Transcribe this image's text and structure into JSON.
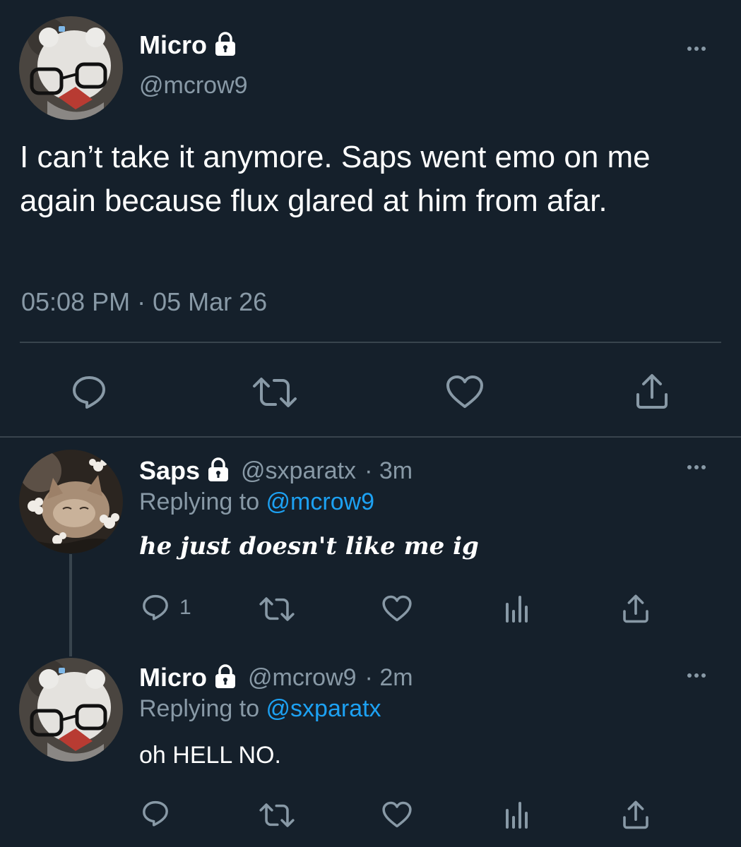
{
  "main_tweet": {
    "display_name": "Micro",
    "handle": "@mcrow9",
    "text": "I can’t take it anymore. Saps went emo on me again because flux glared at him from afar.",
    "timestamp": "05:08 PM · 05 Mar 26",
    "avatar_icon": "avatar-bear-with-glasses",
    "protected_icon": "lock-icon"
  },
  "replies": [
    {
      "display_name": "Saps",
      "handle": "@sxparatx",
      "time_ago": "· 3m",
      "replying_prefix": "Replying to ",
      "replying_to": "@mcrow9",
      "text": "he just doesn't like me ig",
      "reply_count": "1",
      "avatar_icon": "avatar-cat-with-flowers"
    },
    {
      "display_name": "Micro",
      "handle": "@mcrow9",
      "time_ago": "· 2m",
      "replying_prefix": "Replying to ",
      "replying_to": "@sxparatx",
      "text": "oh HELL NO.",
      "reply_count": "",
      "avatar_icon": "avatar-bear-with-glasses"
    }
  ],
  "colors": {
    "background": "#15202b",
    "text": "#ffffff",
    "muted": "#8899a6",
    "link": "#1da1f2",
    "divider": "#38444d"
  }
}
